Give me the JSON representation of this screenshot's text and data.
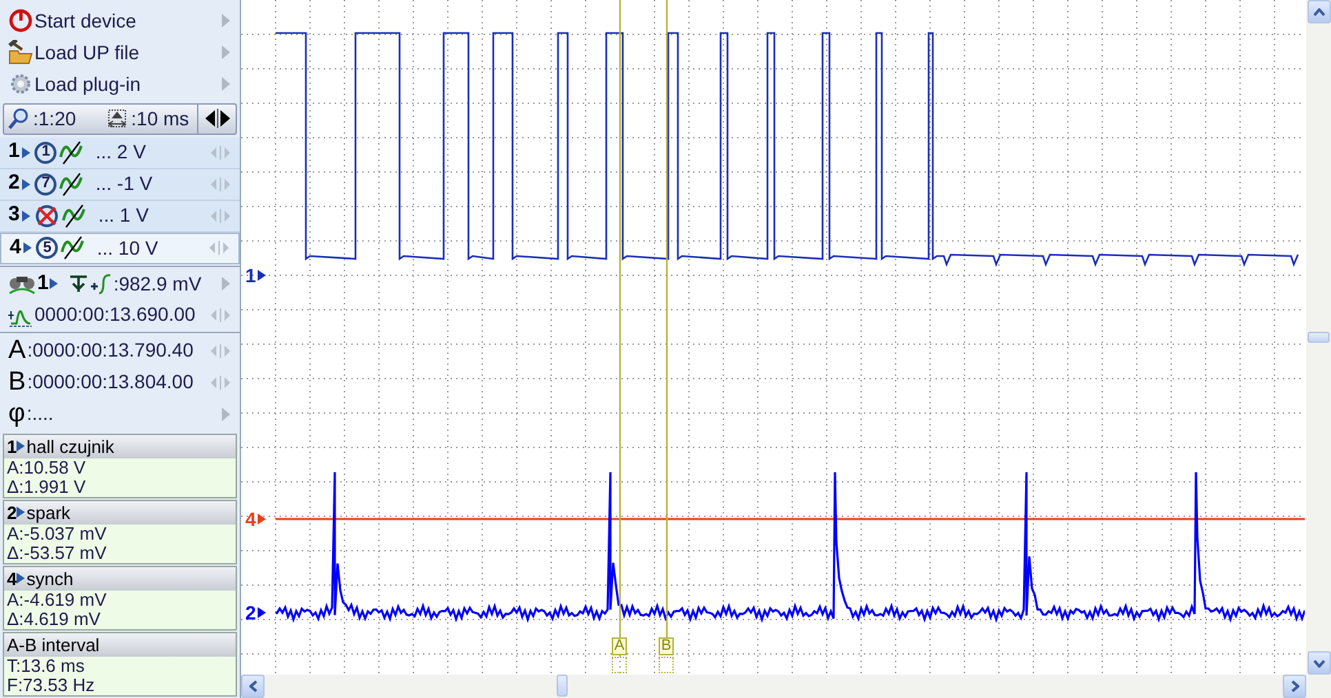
{
  "menu": [
    {
      "kind": "power",
      "label": "Start device"
    },
    {
      "kind": "folder",
      "label": "Load UP file"
    },
    {
      "kind": "gear",
      "label": "Load plug-in"
    }
  ],
  "scale": {
    "zoom": ":1:20",
    "timebase": ":10 ms"
  },
  "channels": [
    {
      "number": "1",
      "enabled": true,
      "probe": "1",
      "range": "... 2 V",
      "selected": false
    },
    {
      "number": "2",
      "enabled": true,
      "probe": "7",
      "range": "... -1 V",
      "selected": false
    },
    {
      "number": "3",
      "enabled": false,
      "range": "... 1 V",
      "selected": false
    },
    {
      "number": "4",
      "enabled": true,
      "probe": "5",
      "range": "... 10 V",
      "selected": true
    }
  ],
  "trigger": {
    "channel": "1",
    "level": ":982.9 mV",
    "time": "0000:00:13.690.00"
  },
  "cursors": [
    {
      "label": "A",
      "value": ":0000:00:13.790.40"
    },
    {
      "label": "B",
      "value": ":0000:00:13.804.00"
    },
    {
      "label": "φ",
      "value": ":...."
    }
  ],
  "measurements": [
    {
      "kind": "channel",
      "number": "1",
      "title": "hall czujnik",
      "lines": [
        "A:10.58 V",
        "Δ:1.991 V"
      ]
    },
    {
      "kind": "channel",
      "number": "2",
      "title": "spark",
      "lines": [
        "A:-5.037 mV",
        "Δ:-53.57 mV"
      ]
    },
    {
      "kind": "channel",
      "number": "4",
      "title": "synch",
      "lines": [
        "A:-4.619 mV",
        "Δ:4.619 mV"
      ]
    },
    {
      "kind": "interval",
      "title": "A-B interval",
      "lines": [
        "T:13.6 ms",
        "F:73.53 Hz"
      ]
    }
  ],
  "plot": {
    "markers": [
      {
        "label": "1",
        "color": "#1a2fb8"
      },
      {
        "label": "4",
        "color": "#e8401c"
      },
      {
        "label": "2",
        "color": "#0000ff"
      }
    ],
    "cursors": [
      {
        "label": "A"
      },
      {
        "label": "B"
      }
    ]
  }
}
